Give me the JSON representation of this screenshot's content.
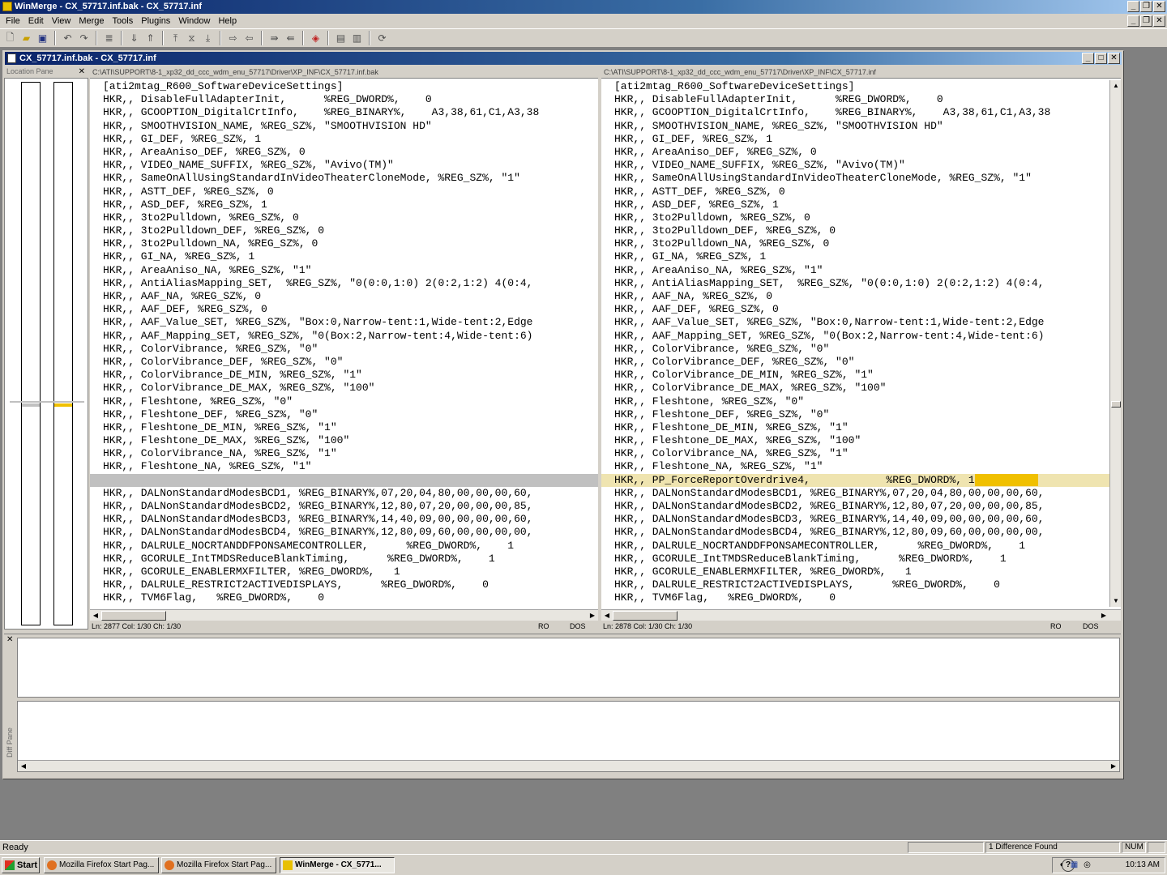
{
  "window": {
    "title": "WinMerge - CX_57717.inf.bak - CX_57717.inf",
    "child_title": "CX_57717.inf.bak - CX_57717.inf"
  },
  "menu": [
    "File",
    "Edit",
    "View",
    "Merge",
    "Tools",
    "Plugins",
    "Window",
    "Help"
  ],
  "location_pane": {
    "label": "Location Pane",
    "colors": {
      "diff_marker": "#f0c000",
      "blank_marker": "#c0c0c0"
    }
  },
  "left": {
    "path": "C:\\ATI\\SUPPORT\\8-1_xp32_dd_ccc_wdm_enu_57717\\Driver\\XP_INF\\CX_57717.inf.bak",
    "lines": [
      "[ati2mtag_R600_SoftwareDeviceSettings]",
      "HKR,, DisableFullAdapterInit,      %REG_DWORD%,    0",
      "HKR,, GCOOPTION_DigitalCrtInfo,    %REG_BINARY%,    A3,38,61,C1,A3,38",
      "HKR,, SMOOTHVISION_NAME, %REG_SZ%, \"SMOOTHVISION HD\"",
      "HKR,, GI_DEF, %REG_SZ%, 1",
      "HKR,, AreaAniso_DEF, %REG_SZ%, 0",
      "HKR,, VIDEO_NAME_SUFFIX, %REG_SZ%, \"Avivo(TM)\"",
      "HKR,, SameOnAllUsingStandardInVideoTheaterCloneMode, %REG_SZ%, \"1\"",
      "HKR,, ASTT_DEF, %REG_SZ%, 0",
      "HKR,, ASD_DEF, %REG_SZ%, 1",
      "HKR,, 3to2Pulldown, %REG_SZ%, 0",
      "HKR,, 3to2Pulldown_DEF, %REG_SZ%, 0",
      "HKR,, 3to2Pulldown_NA, %REG_SZ%, 0",
      "HKR,, GI_NA, %REG_SZ%, 1",
      "HKR,, AreaAniso_NA, %REG_SZ%, \"1\"",
      "HKR,, AntiAliasMapping_SET,  %REG_SZ%, \"0(0:0,1:0) 2(0:2,1:2) 4(0:4,",
      "HKR,, AAF_NA, %REG_SZ%, 0",
      "HKR,, AAF_DEF, %REG_SZ%, 0",
      "HKR,, AAF_Value_SET, %REG_SZ%, \"Box:0,Narrow-tent:1,Wide-tent:2,Edge",
      "HKR,, AAF_Mapping_SET, %REG_SZ%, \"0(Box:2,Narrow-tent:4,Wide-tent:6)",
      "HKR,, ColorVibrance, %REG_SZ%, \"0\"",
      "HKR,, ColorVibrance_DEF, %REG_SZ%, \"0\"",
      "HKR,, ColorVibrance_DE_MIN, %REG_SZ%, \"1\"",
      "HKR,, ColorVibrance_DE_MAX, %REG_SZ%, \"100\"",
      "HKR,, Fleshtone, %REG_SZ%, \"0\"",
      "HKR,, Fleshtone_DEF, %REG_SZ%, \"0\"",
      "HKR,, Fleshtone_DE_MIN, %REG_SZ%, \"1\"",
      "HKR,, Fleshtone_DE_MAX, %REG_SZ%, \"100\"",
      "HKR,, ColorVibrance_NA, %REG_SZ%, \"1\"",
      "HKR,, Fleshtone_NA, %REG_SZ%, \"1\"",
      "",
      "HKR,, DALNonStandardModesBCD1, %REG_BINARY%,07,20,04,80,00,00,00,60,",
      "HKR,, DALNonStandardModesBCD2, %REG_BINARY%,12,80,07,20,00,00,00,85,",
      "HKR,, DALNonStandardModesBCD3, %REG_BINARY%,14,40,09,00,00,00,00,60,",
      "HKR,, DALNonStandardModesBCD4, %REG_BINARY%,12,80,09,60,00,00,00,00,",
      "HKR,, DALRULE_NOCRTANDDFPONSAMECONTROLLER,      %REG_DWORD%,    1",
      "HKR,, GCORULE_IntTMDSReduceBlankTiming,      %REG_DWORD%,    1",
      "HKR,, GCORULE_ENABLERMXFILTER, %REG_DWORD%,   1",
      "HKR,, DALRULE_RESTRICT2ACTIVEDISPLAYS,      %REG_DWORD%,    0",
      "HKR,, TVM6Flag,   %REG_DWORD%,    0"
    ],
    "status": {
      "position": "Ln: 2877  Col: 1/30  Ch: 1/30",
      "mode": "RO",
      "eol": "DOS"
    }
  },
  "right": {
    "path": "C:\\ATI\\SUPPORT\\8-1_xp32_dd_ccc_wdm_enu_57717\\Driver\\XP_INF\\CX_57717.inf",
    "lines": [
      "[ati2mtag_R600_SoftwareDeviceSettings]",
      "HKR,, DisableFullAdapterInit,      %REG_DWORD%,    0",
      "HKR,, GCOOPTION_DigitalCrtInfo,    %REG_BINARY%,    A3,38,61,C1,A3,38",
      "HKR,, SMOOTHVISION_NAME, %REG_SZ%, \"SMOOTHVISION HD\"",
      "HKR,, GI_DEF, %REG_SZ%, 1",
      "HKR,, AreaAniso_DEF, %REG_SZ%, 0",
      "HKR,, VIDEO_NAME_SUFFIX, %REG_SZ%, \"Avivo(TM)\"",
      "HKR,, SameOnAllUsingStandardInVideoTheaterCloneMode, %REG_SZ%, \"1\"",
      "HKR,, ASTT_DEF, %REG_SZ%, 0",
      "HKR,, ASD_DEF, %REG_SZ%, 1",
      "HKR,, 3to2Pulldown, %REG_SZ%, 0",
      "HKR,, 3to2Pulldown_DEF, %REG_SZ%, 0",
      "HKR,, 3to2Pulldown_NA, %REG_SZ%, 0",
      "HKR,, GI_NA, %REG_SZ%, 1",
      "HKR,, AreaAniso_NA, %REG_SZ%, \"1\"",
      "HKR,, AntiAliasMapping_SET,  %REG_SZ%, \"0(0:0,1:0) 2(0:2,1:2) 4(0:4,",
      "HKR,, AAF_NA, %REG_SZ%, 0",
      "HKR,, AAF_DEF, %REG_SZ%, 0",
      "HKR,, AAF_Value_SET, %REG_SZ%, \"Box:0,Narrow-tent:1,Wide-tent:2,Edge",
      "HKR,, AAF_Mapping_SET, %REG_SZ%, \"0(Box:2,Narrow-tent:4,Wide-tent:6)",
      "HKR,, ColorVibrance, %REG_SZ%, \"0\"",
      "HKR,, ColorVibrance_DEF, %REG_SZ%, \"0\"",
      "HKR,, ColorVibrance_DE_MIN, %REG_SZ%, \"1\"",
      "HKR,, ColorVibrance_DE_MAX, %REG_SZ%, \"100\"",
      "HKR,, Fleshtone, %REG_SZ%, \"0\"",
      "HKR,, Fleshtone_DEF, %REG_SZ%, \"0\"",
      "HKR,, Fleshtone_DE_MIN, %REG_SZ%, \"1\"",
      "HKR,, Fleshtone_DE_MAX, %REG_SZ%, \"100\"",
      "HKR,, ColorVibrance_NA, %REG_SZ%, \"1\"",
      "HKR,, Fleshtone_NA, %REG_SZ%, \"1\"",
      "HKR,, PP_ForceReportOverdrive4,            %REG_DWORD%, 1",
      "HKR,, DALNonStandardModesBCD1, %REG_BINARY%,07,20,04,80,00,00,00,60,",
      "HKR,, DALNonStandardModesBCD2, %REG_BINARY%,12,80,07,20,00,00,00,85,",
      "HKR,, DALNonStandardModesBCD3, %REG_BINARY%,14,40,09,00,00,00,00,60,",
      "HKR,, DALNonStandardModesBCD4, %REG_BINARY%,12,80,09,60,00,00,00,00,",
      "HKR,, DALRULE_NOCRTANDDFPONSAMECONTROLLER,      %REG_DWORD%,    1",
      "HKR,, GCORULE_IntTMDSReduceBlankTiming,      %REG_DWORD%,    1",
      "HKR,, GCORULE_ENABLERMXFILTER, %REG_DWORD%,   1",
      "HKR,, DALRULE_RESTRICT2ACTIVEDISPLAYS,      %REG_DWORD%,    0",
      "HKR,, TVM6Flag,   %REG_DWORD%,    0"
    ],
    "status": {
      "position": "Ln: 2878  Col: 1/30  Ch: 1/30",
      "mode": "RO",
      "eol": "DOS"
    }
  },
  "diff_pane": {
    "label": "Diff Pane"
  },
  "statusbar": {
    "ready": "Ready",
    "diff_count": "1 Difference Found",
    "num": "NUM"
  },
  "taskbar": {
    "start": "Start",
    "tasks": [
      "Mozilla Firefox Start Pag...",
      "Mozilla Firefox Start Pag...",
      "WinMerge - CX_5771..."
    ],
    "clock": "10:13 AM"
  }
}
